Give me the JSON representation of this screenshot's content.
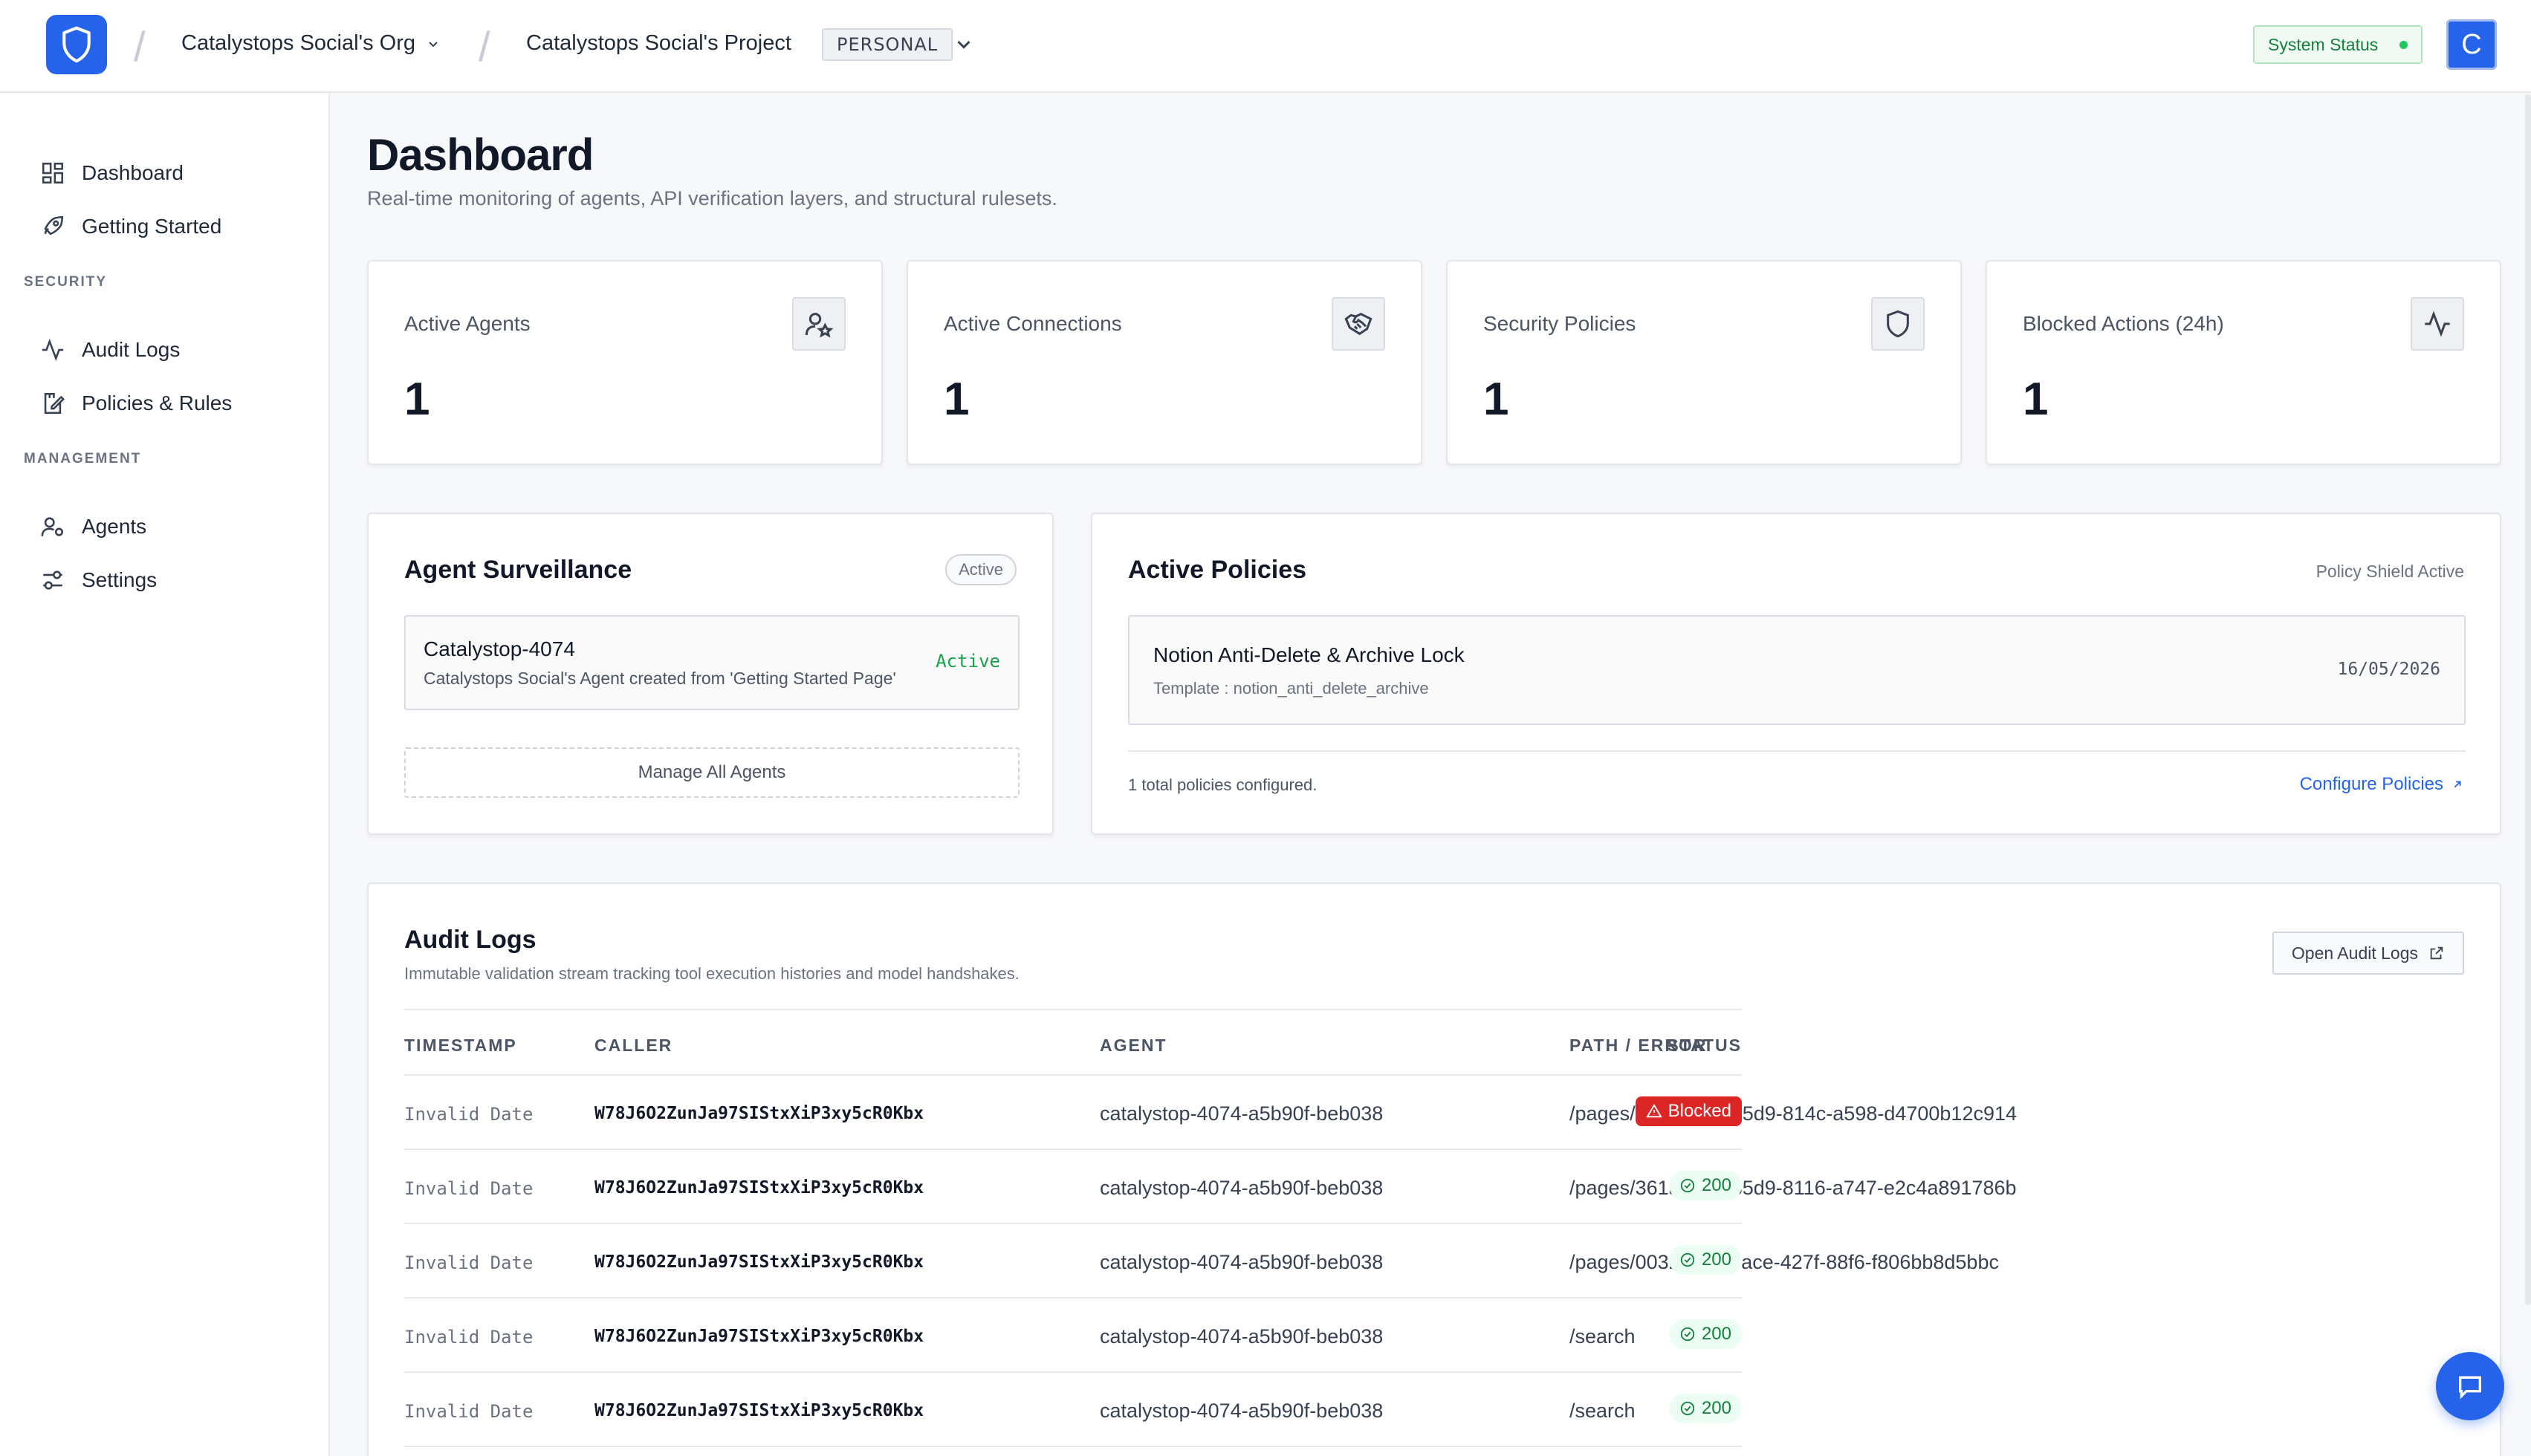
{
  "header": {
    "org": "Catalystops Social's Org",
    "project": "Catalystops Social's Project",
    "plan_tag": "PERSONAL",
    "system_status": "System Status",
    "avatar_letter": "C"
  },
  "sidebar": {
    "items": [
      {
        "label": "Dashboard",
        "icon": "dashboard-icon"
      },
      {
        "label": "Getting Started",
        "icon": "rocket-icon"
      }
    ],
    "security_label": "SECURITY",
    "security_items": [
      {
        "label": "Audit Logs",
        "icon": "activity-icon"
      },
      {
        "label": "Policies & Rules",
        "icon": "policy-edit-icon"
      }
    ],
    "management_label": "MANAGEMENT",
    "management_items": [
      {
        "label": "Agents",
        "icon": "agent-icon"
      },
      {
        "label": "Settings",
        "icon": "sliders-icon"
      }
    ]
  },
  "page": {
    "title": "Dashboard",
    "subtitle": "Real-time monitoring of agents, API verification layers, and structural rulesets."
  },
  "stats": [
    {
      "label": "Active Agents",
      "value": "1",
      "icon": "user-star-icon"
    },
    {
      "label": "Active Connections",
      "value": "1",
      "icon": "handshake-icon"
    },
    {
      "label": "Security Policies",
      "value": "1",
      "icon": "shield-icon"
    },
    {
      "label": "Blocked Actions (24h)",
      "value": "1",
      "icon": "pulse-icon"
    }
  ],
  "surveillance": {
    "title": "Agent Surveillance",
    "badge": "Active",
    "agent_name": "Catalystop-4074",
    "agent_desc": "Catalystops Social's Agent created from 'Getting Started Page'",
    "agent_status": "Active",
    "manage_button": "Manage All Agents"
  },
  "policies": {
    "title": "Active Policies",
    "shield_status": "Policy Shield Active",
    "policy_name": "Notion Anti-Delete & Archive Lock",
    "policy_template": "Template : notion_anti_delete_archive",
    "policy_date": "16/05/2026",
    "total": "1 total policies configured.",
    "configure_link": "Configure Policies"
  },
  "audit": {
    "title": "Audit Logs",
    "subtitle": "Immutable validation stream tracking tool execution histories and model handshakes.",
    "open_button": "Open Audit Logs",
    "columns": [
      "TIMESTAMP",
      "CALLER",
      "AGENT",
      "PATH / ERROR",
      "STATUS"
    ],
    "rows": [
      {
        "timestamp": "Invalid Date",
        "caller": "W78J6O2ZunJa97SIStxXiP3xy5cR0Kbx",
        "agent": "catalystop-4074-a5b90f-beb038",
        "path": "/pages/35eaba8d-85d9-814c-a598-d4700b12c914",
        "status": "Blocked"
      },
      {
        "timestamp": "Invalid Date",
        "caller": "W78J6O2ZunJa97SIStxXiP3xy5cR0Kbx",
        "agent": "catalystop-4074-a5b90f-beb038",
        "path": "/pages/361aba8d-85d9-8116-a747-e2c4a891786b",
        "status": "200"
      },
      {
        "timestamp": "Invalid Date",
        "caller": "W78J6O2ZunJa97SIStxXiP3xy5cR0Kbx",
        "agent": "catalystop-4074-a5b90f-beb038",
        "path": "/pages/0032c218-3ace-427f-88f6-f806bb8d5bbc",
        "status": "200"
      },
      {
        "timestamp": "Invalid Date",
        "caller": "W78J6O2ZunJa97SIStxXiP3xy5cR0Kbx",
        "agent": "catalystop-4074-a5b90f-beb038",
        "path": "/search",
        "status": "200"
      },
      {
        "timestamp": "Invalid Date",
        "caller": "W78J6O2ZunJa97SIStxXiP3xy5cR0Kbx",
        "agent": "catalystop-4074-a5b90f-beb038",
        "path": "/search",
        "status": "200"
      }
    ]
  },
  "colors": {
    "accent": "#2563eb",
    "success": "#15803d",
    "danger": "#dc2626"
  }
}
